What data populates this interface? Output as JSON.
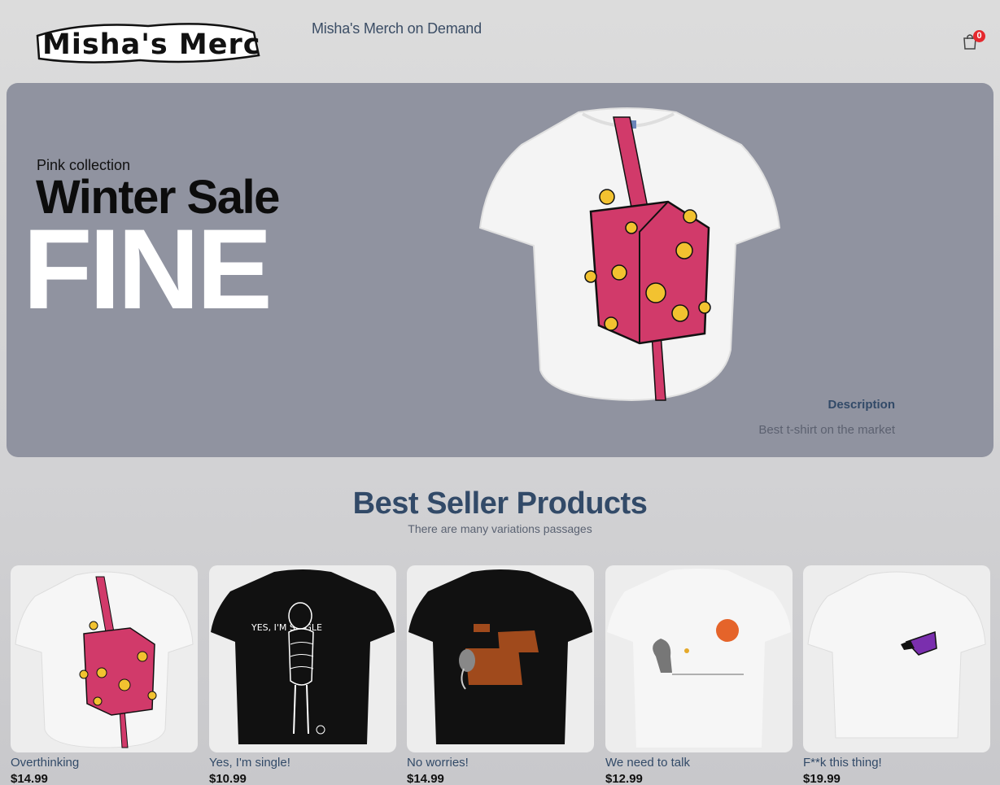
{
  "nav": {
    "logo_text": "Misha's Merch",
    "tagline": "Misha's Merch on Demand",
    "cart_icon": "shopping-bag-icon",
    "cart_count": "0"
  },
  "hero": {
    "subtitle": "Pink collection",
    "title": "Winter Sale",
    "big_text": "FINE",
    "description_title": "Description",
    "description_text": "Best t-shirt on the market",
    "background_color": "#9093a0"
  },
  "best_sellers": {
    "title": "Best Seller Products",
    "subtitle": "There are many variations passages",
    "products": [
      {
        "name": "Overthinking",
        "price": "$14.99",
        "shirt_color": "#ffffff",
        "design": "pink-cube"
      },
      {
        "name": "Yes, I'm single!",
        "price": "$10.99",
        "shirt_color": "#111111",
        "design": "single-figure",
        "design_text": "YES, I'M SINGLE"
      },
      {
        "name": "No worries!",
        "price": "$14.99",
        "shirt_color": "#111111",
        "design": "mammoths"
      },
      {
        "name": "We need to talk",
        "price": "$12.99",
        "shirt_color": "#ffffff",
        "design": "elephant-sun"
      },
      {
        "name": "F**k this thing!",
        "price": "$19.99",
        "shirt_color": "#ffffff",
        "design": "purple-creature"
      }
    ]
  },
  "colors": {
    "accent": "#324a68",
    "badge": "#e5282e",
    "pink": "#d13a6a",
    "yellow": "#f2c230"
  }
}
